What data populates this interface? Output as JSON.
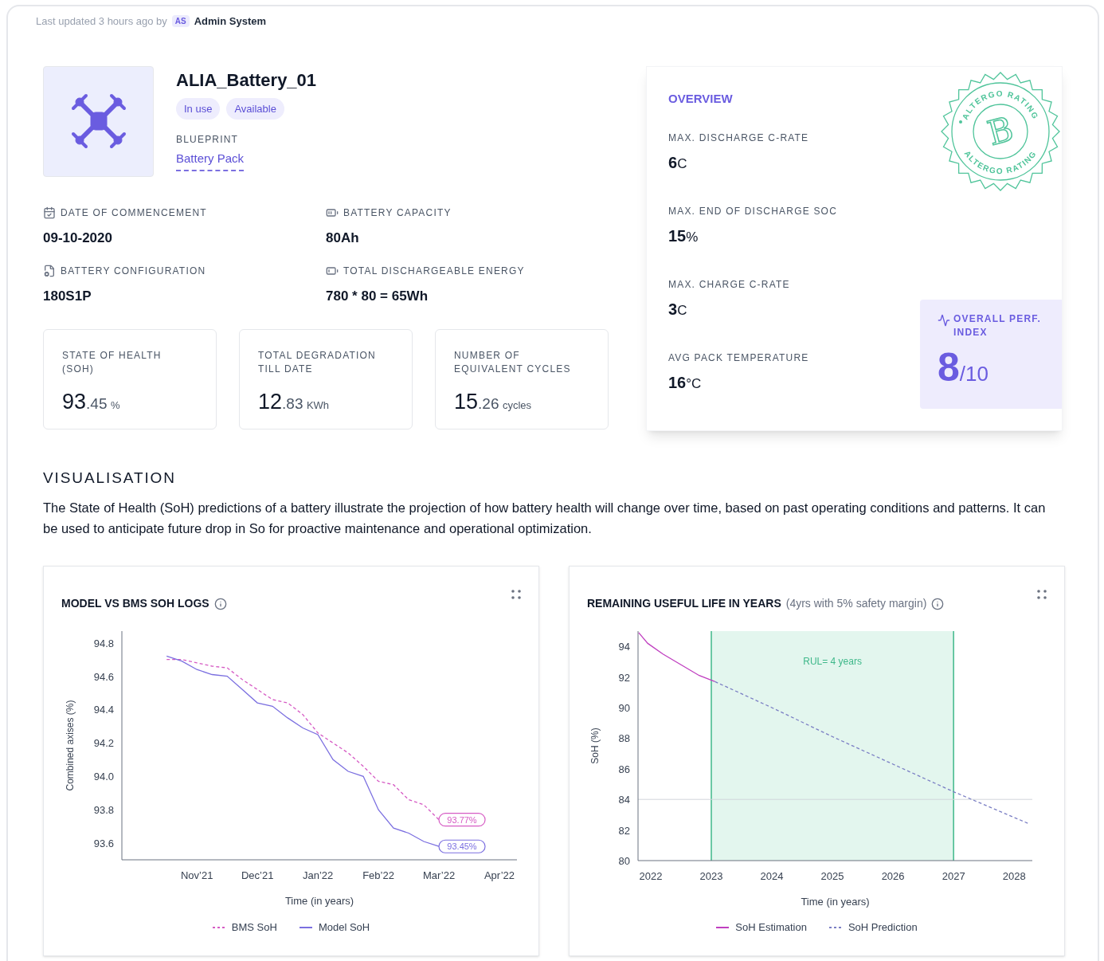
{
  "header": {
    "updated_text": "Last updated 3 hours ago by",
    "avatar": "AS",
    "user": "Admin System"
  },
  "asset": {
    "name": "ALIA_Battery_01",
    "tags": [
      "In use",
      "Available"
    ],
    "blueprint_label": "BLUEPRINT",
    "blueprint_link": "Battery Pack"
  },
  "details": [
    {
      "label": "DATE OF COMMENCEMENT",
      "value": "09-10-2020"
    },
    {
      "label": "BATTERY CAPACITY",
      "value": "80Ah"
    },
    {
      "label": "BATTERY CONFIGURATION",
      "value": "180S1P"
    },
    {
      "label": "TOTAL DISCHARGEABLE ENERGY",
      "value": "780 * 80 = 65Wh"
    }
  ],
  "stats": [
    {
      "label": "STATE OF HEALTH (SOH)",
      "major": "93",
      "minor": ".45",
      "unit": "%"
    },
    {
      "label": "TOTAL DEGRADATION TILL DATE",
      "major": "12",
      "minor": ".83",
      "unit": "KWh"
    },
    {
      "label": "NUMBER OF EQUIVALENT CYCLES",
      "major": "15",
      "minor": ".26",
      "unit": "cycles"
    }
  ],
  "overview": {
    "title": "OVERVIEW",
    "items": [
      {
        "label": "MAX. DISCHARGE C-RATE",
        "value": "6",
        "unit": "C"
      },
      {
        "label": "MAX. END OF DISCHARGE SOC",
        "value": "15",
        "unit": "%"
      },
      {
        "label": "MAX. CHARGE C-RATE",
        "value": "3",
        "unit": "C"
      },
      {
        "label": "AVG PACK TEMPERATURE",
        "value": "16",
        "unit": "°C"
      }
    ],
    "stamp": {
      "letter": "B",
      "ring_texts": [
        "ALTERGO RATING",
        "ALTERGO RATING"
      ]
    },
    "perf": {
      "label": "OVERALL PERF. INDEX",
      "score": "8",
      "max": "/10"
    }
  },
  "visualisation": {
    "title": "VISUALISATION",
    "description": "The State of Health (SoH) predictions of a battery illustrate the projection of how battery health will change over time, based on past operating conditions and patterns. It can be used to anticipate future drop in So for proactive maintenance and operational optimization."
  },
  "charts": [
    {
      "title": "MODEL VS BMS SOH LOGS",
      "chart_data": {
        "type": "line",
        "legend": "bottom",
        "xlabel": "Time (in years)",
        "ylabel": "Combined axises (%)",
        "categories": [
          null,
          null,
          "Nov’21",
          null,
          null,
          null,
          "Dec’21",
          null,
          null,
          null,
          "Jan’22",
          null,
          null,
          null,
          "Feb’22",
          null,
          null,
          null,
          "Mar’22",
          null,
          null,
          null,
          "Apr’22"
        ],
        "series": [
          {
            "name": "BMS SoH",
            "color": "#d65bc4",
            "line_style": "dashed",
            "values": [
              94.7,
              94.7,
              94.68,
              94.66,
              94.65,
              94.58,
              94.52,
              94.46,
              94.44,
              94.37,
              94.26,
              94.2,
              94.14,
              94.06,
              93.97,
              93.95,
              93.86,
              93.83,
              93.74,
              null,
              null,
              null,
              null
            ]
          },
          {
            "name": "Model SoH",
            "color": "#7b6fe0",
            "line_style": "solid",
            "values": [
              94.72,
              94.69,
              94.64,
              94.61,
              94.6,
              94.52,
              94.44,
              94.42,
              94.35,
              94.29,
              94.25,
              94.1,
              94.03,
              94.0,
              93.8,
              93.69,
              93.66,
              93.61,
              93.58,
              null,
              null,
              null,
              null
            ]
          }
        ],
        "ylim": [
          93.5,
          94.87
        ],
        "yticks": [
          {
            "value": 93.6,
            "label": "93.6"
          },
          {
            "value": 93.8,
            "label": "93.8"
          },
          {
            "value": 94.0,
            "label": "94.0"
          },
          {
            "value": 94.2,
            "label": "94.2"
          },
          {
            "value": 94.4,
            "label": "94.4"
          },
          {
            "value": 94.6,
            "label": "94.6"
          },
          {
            "value": 94.8,
            "label": "94.8"
          }
        ],
        "annotations": [
          {
            "text": "93.77%"
          },
          {
            "text": "93.45%"
          }
        ]
      }
    },
    {
      "title": "REMAINING USEFUL LIFE IN YEARS",
      "subtitle": "(4yrs with 5% safety margin)",
      "chart_data": {
        "type": "line",
        "legend": "bottom",
        "xlabel": "Time (in years)",
        "ylabel": "SoH (%)",
        "x": [
          2021.8,
          2021.95,
          2022.2,
          2022.5,
          2022.8,
          2023.06,
          2024,
          2025,
          2026,
          2027,
          2028.25
        ],
        "series": [
          {
            "name": "SoH Estimation",
            "color": "#c03fc0",
            "line_style": "solid",
            "values": [
              94.9,
              94.2,
              93.5,
              92.8,
              92.1,
              91.7,
              null,
              null,
              null,
              null,
              null
            ]
          },
          {
            "name": "SoH Prediction",
            "color": "#7b7fc4",
            "line_style": "dashed",
            "values": [
              null,
              null,
              null,
              null,
              null,
              91.7,
              90.0,
              88.1,
              86.3,
              84.5,
              82.4
            ]
          }
        ],
        "xlim": [
          2021.79,
          2028.3
        ],
        "ylim": [
          80,
          95
        ],
        "xticks": [
          2022,
          2023,
          2024,
          2025,
          2026,
          2027,
          2028
        ],
        "yticks": [
          80,
          82,
          84,
          86,
          88,
          90,
          92,
          94
        ],
        "bands": [
          {
            "axis": "x",
            "from": 2023,
            "to": 2027,
            "label": "RUL= 4 years",
            "color": "#e3f6ee"
          }
        ],
        "ref_lines": [
          {
            "axis": "y",
            "value": 84,
            "color": "#d1d5db"
          }
        ]
      }
    }
  ]
}
